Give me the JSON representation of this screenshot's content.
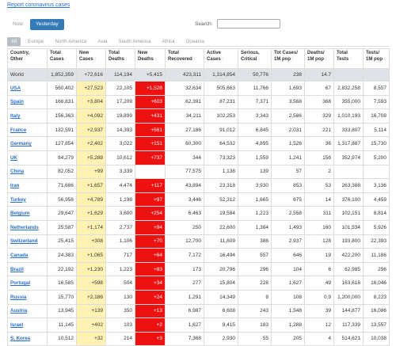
{
  "report_link": "Report coronavirus cases",
  "day_tabs": [
    "Now",
    "Yesterday"
  ],
  "search": {
    "label": "Search:",
    "placeholder": ""
  },
  "regions": [
    "All",
    "Europe",
    "North America",
    "Asia",
    "South America",
    "Africa",
    "Oceania"
  ],
  "columns": [
    "Country, Other",
    "Total Cases",
    "New Cases",
    "Total Deaths",
    "New Deaths",
    "Total Recovered",
    "Active Cases",
    "Serious, Critical",
    "Tot Cases/ 1M pop",
    "Deaths/ 1M pop",
    "Total Tests",
    "Tests/ 1M pop"
  ],
  "world": [
    "World",
    "1,852,359",
    "+72,616",
    "114,194",
    "+5,415",
    "423,311",
    "1,314,854",
    "50,776",
    "238",
    "14.7",
    "",
    ""
  ],
  "rows": [
    [
      "USA",
      "560,402",
      "+27,523",
      "22,105",
      "+1,528",
      "32,634",
      "505,663",
      "11,766",
      "1,693",
      "67",
      "2,832,258",
      "8,557"
    ],
    [
      "Spain",
      "166,831",
      "+3,804",
      "17,209",
      "+603",
      "62,391",
      "87,231",
      "7,371",
      "3,568",
      "368",
      "355,000",
      "7,593"
    ],
    [
      "Italy",
      "156,363",
      "+4,092",
      "19,899",
      "+431",
      "34,211",
      "102,253",
      "3,343",
      "2,586",
      "329",
      "1,010,193",
      "16,708"
    ],
    [
      "France",
      "132,591",
      "+2,937",
      "14,393",
      "+561",
      "27,186",
      "91,012",
      "6,845",
      "2,031",
      "221",
      "333,807",
      "5,114"
    ],
    [
      "Germany",
      "127,854",
      "+2,402",
      "3,022",
      "+151",
      "60,300",
      "64,532",
      "4,895",
      "1,526",
      "36",
      "1,317,887",
      "15,730"
    ],
    [
      "UK",
      "84,279",
      "+5,288",
      "10,612",
      "+737",
      "344",
      "73,323",
      "1,559",
      "1,241",
      "156",
      "352,974",
      "5,200"
    ],
    [
      "China",
      "82,052",
      "+99",
      "3,339",
      "",
      "77,575",
      "1,138",
      "139",
      "57",
      "2",
      "",
      ""
    ],
    [
      "Iran",
      "71,686",
      "+1,657",
      "4,474",
      "+117",
      "43,894",
      "23,318",
      "3,930",
      "853",
      "53",
      "263,388",
      "3,136"
    ],
    [
      "Turkey",
      "56,956",
      "+4,789",
      "1,198",
      "+97",
      "3,446",
      "52,312",
      "1,665",
      "675",
      "14",
      "376,100",
      "4,459"
    ],
    [
      "Belgium",
      "29,647",
      "+1,629",
      "3,600",
      "+254",
      "6,463",
      "19,584",
      "1,223",
      "2,558",
      "311",
      "102,151",
      "8,814"
    ],
    [
      "Netherlands",
      "25,587",
      "+1,174",
      "2,737",
      "+94",
      "250",
      "22,600",
      "1,384",
      "1,493",
      "160",
      "101,534",
      "5,926"
    ],
    [
      "Switzerland",
      "25,415",
      "+308",
      "1,106",
      "+70",
      "12,700",
      "11,609",
      "386",
      "2,937",
      "128",
      "193,800",
      "22,393"
    ],
    [
      "Canada",
      "24,383",
      "+1,065",
      "717",
      "+64",
      "7,172",
      "16,494",
      "557",
      "646",
      "19",
      "422,200",
      "11,186"
    ],
    [
      "Brazil",
      "22,192",
      "+1,230",
      "1,223",
      "+83",
      "173",
      "20,796",
      "296",
      "104",
      "6",
      "62,985",
      "296"
    ],
    [
      "Portugal",
      "16,585",
      "+598",
      "504",
      "+34",
      "277",
      "15,804",
      "228",
      "1,627",
      "49",
      "163,616",
      "16,046"
    ],
    [
      "Russia",
      "15,770",
      "+2,186",
      "130",
      "+24",
      "1,291",
      "14,349",
      "8",
      "108",
      "0.9",
      "1,200,000",
      "8,223"
    ],
    [
      "Austria",
      "13,945",
      "+139",
      "350",
      "+13",
      "6,987",
      "6,608",
      "243",
      "1,548",
      "39",
      "144,877",
      "16,086"
    ],
    [
      "Israel",
      "11,145",
      "+402",
      "103",
      "+2",
      "1,627",
      "9,415",
      "183",
      "1,288",
      "12",
      "117,339",
      "13,557"
    ],
    [
      "S. Korea",
      "10,512",
      "+32",
      "214",
      "+3",
      "7,368",
      "2,930",
      "55",
      "205",
      "4",
      "514,621",
      "10,038"
    ]
  ],
  "colors": {
    "link": "#2a6fc9",
    "new_cases_bg": "#fff2b3",
    "new_deaths_bg": "#ee1111",
    "active_tab": "#337ab7",
    "world_row": "#dfe3e8"
  }
}
